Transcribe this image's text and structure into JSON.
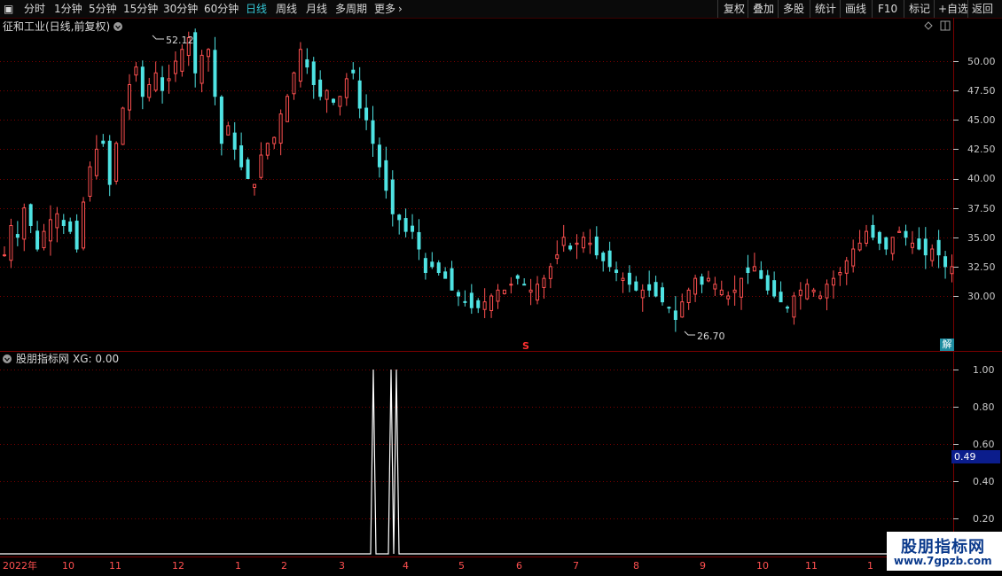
{
  "toolbar": {
    "left": [
      {
        "label": "分时",
        "active": false
      },
      {
        "label": "1分钟",
        "active": false
      },
      {
        "label": "5分钟",
        "active": false
      },
      {
        "label": "15分钟",
        "active": false
      },
      {
        "label": "30分钟",
        "active": false
      },
      {
        "label": "60分钟",
        "active": false
      },
      {
        "label": "日线",
        "active": true
      },
      {
        "label": "周线",
        "active": false
      },
      {
        "label": "月线",
        "active": false
      },
      {
        "label": "多周期",
        "active": false
      },
      {
        "label": "更多",
        "active": false
      }
    ],
    "right": [
      "复权",
      "叠加",
      "多股",
      "统计",
      "画线",
      "F10",
      "标记",
      "+自选",
      "返回"
    ]
  },
  "price_panel": {
    "title": "征和工业(日线,前复权)",
    "high_label": "52.12",
    "low_label": "26.70",
    "axis_labels": [
      "50.00",
      "47.50",
      "45.00",
      "42.50",
      "40.00",
      "37.50",
      "35.00",
      "32.50",
      "30.00"
    ],
    "marker_s": "S",
    "jie_label": "解"
  },
  "indicator_panel": {
    "title": "股朋指标网",
    "xg_label": "XG: 0.00",
    "axis_labels": [
      "1.00",
      "0.80",
      "0.60",
      "0.40",
      "0.20"
    ],
    "current_value": "0.49"
  },
  "time_axis": {
    "labels": [
      "2022年",
      "10",
      "11",
      "12",
      "1",
      "2",
      "3",
      "4",
      "5",
      "6",
      "7",
      "8",
      "9",
      "10",
      "11",
      "1"
    ]
  },
  "watermark": {
    "brand": "股朋指标网",
    "url": "www.7gpzb.com"
  },
  "colors": {
    "up": "#ff5050",
    "down": "#4fe3e3",
    "active_tab": "#35c7d6",
    "grid": "#7a0000",
    "axis_text": "#c8c8c8",
    "indicator_line": "#ffffff"
  },
  "chart_data": [
    {
      "type": "candlestick",
      "title": "征和工业(日线,前复权)",
      "y_range": [
        26.0,
        53.0
      ],
      "y_ticks": [
        30.0,
        32.5,
        35.0,
        37.5,
        40.0,
        42.5,
        45.0,
        47.5,
        50.0
      ],
      "high": 52.12,
      "low": 26.7,
      "close_path": [
        33.5,
        36.0,
        35.0,
        37.5,
        36.0,
        34.0,
        35.5,
        36.5,
        37.0,
        36.0,
        35.5,
        34.0,
        38.0,
        41.0,
        42.5,
        43.0,
        39.5,
        43.0,
        46.0,
        48.0,
        49.5,
        47.0,
        48.0,
        49.0,
        47.5,
        48.5,
        50.0,
        51.0,
        52.0,
        49.0,
        50.5,
        51.0,
        47.0,
        43.0,
        44.5,
        42.5,
        41.0,
        40.0,
        39.5,
        42.0,
        43.0,
        43.5,
        45.5,
        47.0,
        49.0,
        51.0,
        49.5,
        48.0,
        47.0,
        47.5,
        46.5,
        47.0,
        48.5,
        49.0,
        46.0,
        45.0,
        43.0,
        41.0,
        39.0,
        37.0,
        36.5,
        35.5,
        35.5,
        34.0,
        32.0,
        32.5,
        32.0,
        31.5,
        30.5,
        30.0,
        29.5,
        29.0,
        29.0,
        29.5,
        30.0,
        30.5,
        30.5,
        31.0,
        31.5,
        31.0,
        30.5,
        31.0,
        31.5,
        32.5,
        33.5,
        35.0,
        34.0,
        34.5,
        35.0,
        34.5,
        33.5,
        33.0,
        32.5,
        32.0,
        31.5,
        31.0,
        30.5,
        30.5,
        30.5,
        30.0,
        29.5,
        29.0,
        28.0,
        29.5,
        30.5,
        31.5,
        31.0,
        31.5,
        31.0,
        30.5,
        30.0,
        30.5,
        31.5,
        32.0,
        32.5,
        31.5,
        30.5,
        30.0,
        29.5,
        29.0,
        30.0,
        30.5,
        31.0,
        30.5,
        30.0,
        31.0,
        31.5,
        32.0,
        33.0,
        34.0,
        34.5,
        35.5,
        35.0,
        34.5,
        34.0,
        35.0,
        35.5,
        35.0,
        34.5,
        34.0,
        33.5,
        34.0,
        33.5,
        32.5,
        32.5
      ]
    },
    {
      "type": "line",
      "title": "股朋指标网",
      "series": [
        {
          "name": "XG",
          "values": [
            0,
            1,
            0,
            1,
            0
          ]
        }
      ],
      "y_range": [
        0.0,
        1.05
      ],
      "y_ticks": [
        0.2,
        0.4,
        0.6,
        0.8,
        1.0
      ],
      "current_value": 0.49
    }
  ]
}
